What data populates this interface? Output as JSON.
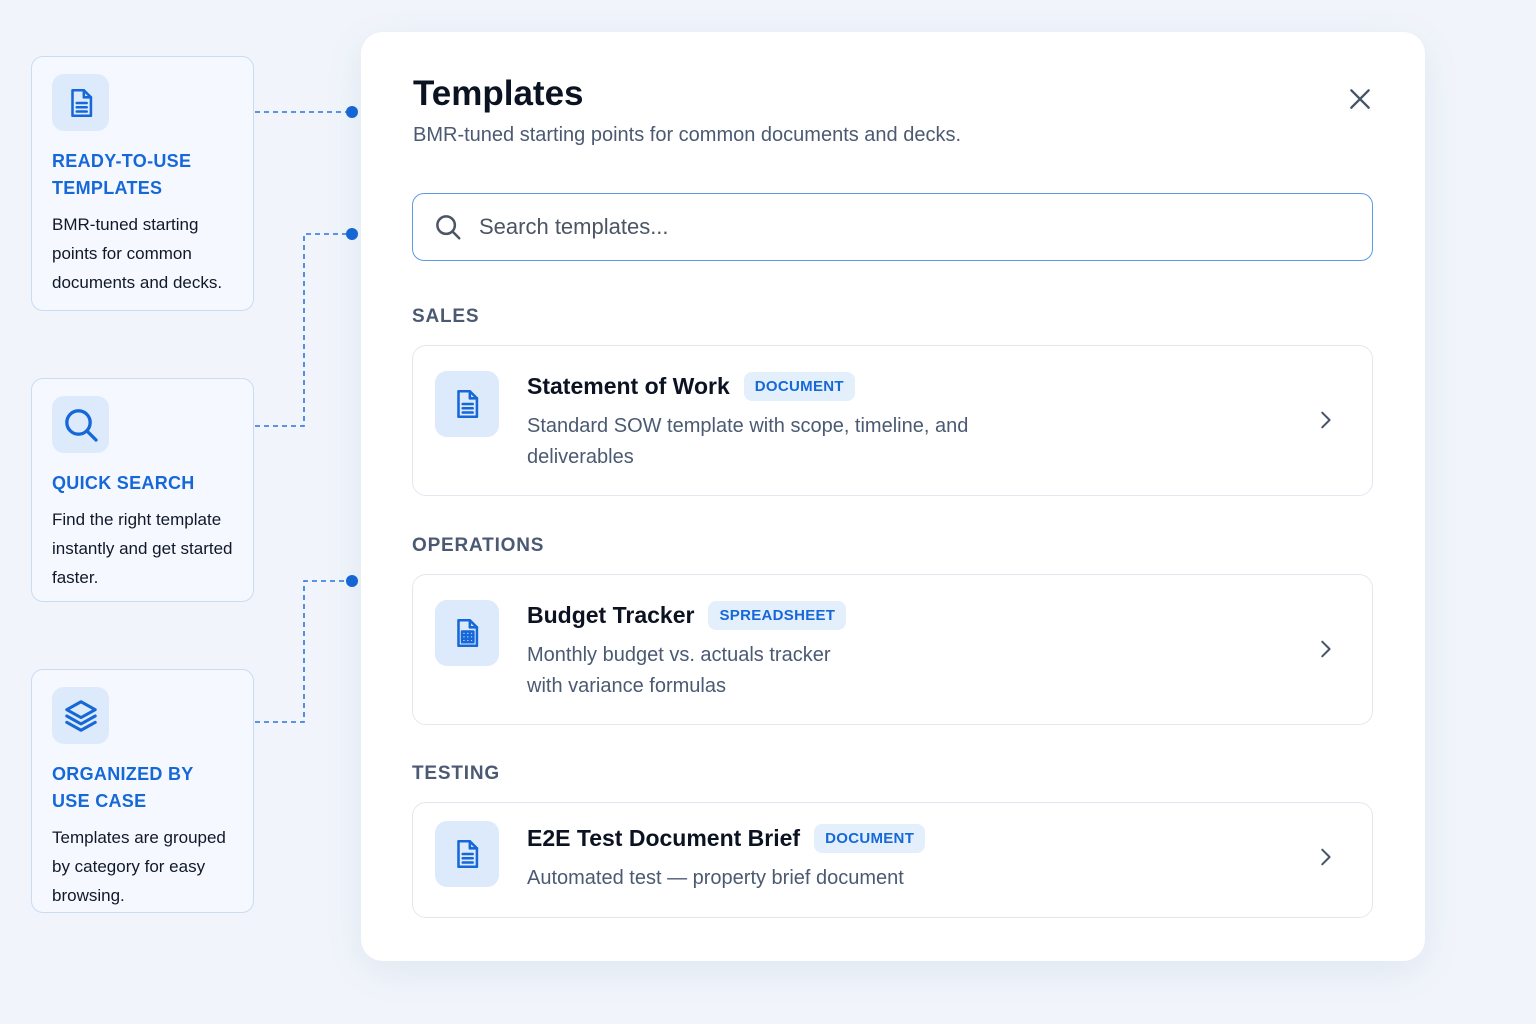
{
  "features": [
    {
      "title": "READY-TO-USE TEMPLATES",
      "description": "BMR-tuned starting points for common documents and decks.",
      "icon": "document-icon"
    },
    {
      "title": "QUICK SEARCH",
      "description": "Find the right template instantly and get started faster.",
      "icon": "search-icon"
    },
    {
      "title": "ORGANIZED BY USE CASE",
      "description": "Templates are grouped by category for easy browsing.",
      "icon": "layers-icon"
    }
  ],
  "modal": {
    "title": "Templates",
    "subtitle": "BMR-tuned starting points for common documents and decks.",
    "close_icon": "close-icon"
  },
  "search": {
    "placeholder": "Search templates...",
    "value": ""
  },
  "sections": [
    {
      "label": "SALES",
      "templates": [
        {
          "name": "Statement of Work",
          "badge": "DOCUMENT",
          "description": "Standard SOW template with scope, timeline, and deliverables",
          "icon": "document-icon"
        }
      ]
    },
    {
      "label": "OPERATIONS",
      "templates": [
        {
          "name": "Budget Tracker",
          "badge": "SPREADSHEET",
          "description": "Monthly budget vs. actuals tracker with variance formulas",
          "icon": "spreadsheet-icon"
        }
      ]
    },
    {
      "label": "TESTING",
      "templates": [
        {
          "name": "E2E Test Document Brief",
          "badge": "DOCUMENT",
          "description": "Automated test — property brief document",
          "icon": "document-icon"
        }
      ]
    }
  ],
  "colors": {
    "accent": "#1668d8",
    "background": "#f1f5fb",
    "icon_bg": "#dceafb",
    "muted_text": "#4b5a72"
  }
}
